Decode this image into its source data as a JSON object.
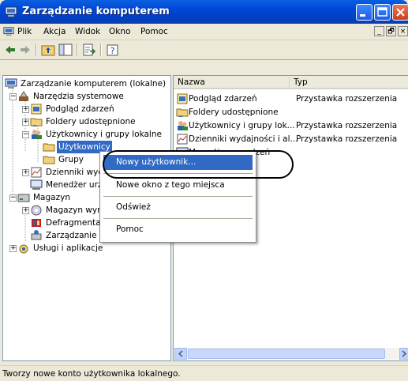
{
  "window": {
    "title": "Zarządzanie komputerem",
    "controls": [
      "minimize",
      "maximize",
      "close"
    ],
    "colors": {
      "titlebar": "#0046d5",
      "selection": "#316ac5"
    }
  },
  "menu": [
    "Plik",
    "Akcja",
    "Widok",
    "Okno",
    "Pomoc"
  ],
  "mdi_controls": [
    "_",
    "🗗",
    "×"
  ],
  "toolbar": {
    "buttons": [
      "back-icon",
      "forward-icon",
      "up-folder-icon",
      "show-hide-tree-icon",
      "export-list-icon",
      "help-icon"
    ]
  },
  "tree": {
    "root": "Zarządzanie komputerem (lokalne)",
    "system_tools": "Narzędzia systemowe",
    "event_viewer": "Podgląd zdarzeń",
    "shared_folders": "Foldery udostępnione",
    "local_users": "Użytkownicy i grupy lokalne",
    "users": "Użytkownicy",
    "groups": "Grupy",
    "perf_logs": "Dzienniki wydajności i alertów",
    "device_manager": "Menedżer urządzeń",
    "storage": "Magazyn",
    "removable_storage": "Magazyn wymienny",
    "defragmenter": "Defragmentator dysków",
    "disk_management": "Zarządzanie dyskami",
    "services_apps": "Usługi i aplikacje"
  },
  "list": {
    "columns": [
      "Nazwa",
      "Typ"
    ],
    "rows": [
      {
        "name": "Podgląd zdarzeń",
        "type": "Przystawka rozszerzenia"
      },
      {
        "name": "Foldery udostępnione",
        "type": ""
      },
      {
        "name": "Użytkownicy i grupy lok...",
        "type": "Przystawka rozszerzenia"
      },
      {
        "name": "Dzienniki wydajności i al...",
        "type": "Przystawka rozszerzenia"
      },
      {
        "name": "Menedżer urządzeń",
        "type": ""
      }
    ]
  },
  "context_menu": {
    "items": [
      "Nowy użytkownik...",
      "Nowe okno z tego miejsca",
      "Odśwież",
      "Pomoc"
    ]
  },
  "status_bar": "Tworzy nowe konto użytkownika lokalnego."
}
